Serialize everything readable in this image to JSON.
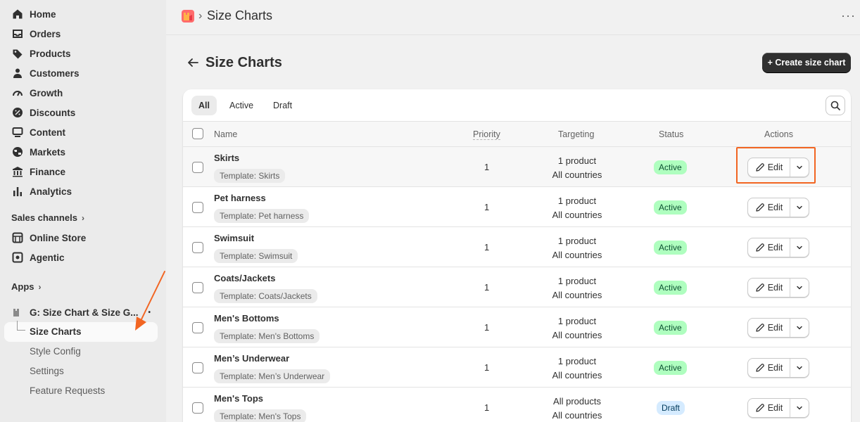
{
  "sidebar": {
    "nav": [
      {
        "label": "Home",
        "icon": "home-icon"
      },
      {
        "label": "Orders",
        "icon": "inbox-icon"
      },
      {
        "label": "Products",
        "icon": "tag-icon"
      },
      {
        "label": "Customers",
        "icon": "person-icon"
      },
      {
        "label": "Growth",
        "icon": "gauge-icon"
      },
      {
        "label": "Discounts",
        "icon": "discount-icon"
      },
      {
        "label": "Content",
        "icon": "content-icon"
      },
      {
        "label": "Markets",
        "icon": "globe-icon"
      },
      {
        "label": "Finance",
        "icon": "bank-icon"
      },
      {
        "label": "Analytics",
        "icon": "bar-chart-icon"
      }
    ],
    "sales_channels": {
      "heading": "Sales channels",
      "items": [
        {
          "label": "Online Store",
          "icon": "store-icon"
        },
        {
          "label": "Agentic",
          "icon": "agentic-icon"
        }
      ]
    },
    "apps": {
      "heading": "Apps",
      "app_name": "G: Size Chart & Size G...",
      "sub_items": [
        "Size Charts",
        "Style Config",
        "Settings",
        "Feature Requests"
      ]
    }
  },
  "topbar": {
    "breadcrumb_title": "Size Charts",
    "more": "···"
  },
  "page": {
    "title": "Size Charts",
    "create_button": "+ Create size chart"
  },
  "tabs": [
    "All",
    "Active",
    "Draft"
  ],
  "table": {
    "headers": [
      "Name",
      "Priority",
      "Targeting",
      "Status",
      "Actions"
    ],
    "edit_label": "Edit",
    "rows": [
      {
        "name": "Skirts",
        "template": "Template: Skirts",
        "priority": "1",
        "targeting_1": "1 product",
        "targeting_2": "All countries",
        "status": "Active"
      },
      {
        "name": "Pet harness",
        "template": "Template: Pet harness",
        "priority": "1",
        "targeting_1": "1 product",
        "targeting_2": "All countries",
        "status": "Active"
      },
      {
        "name": "Swimsuit",
        "template": "Template: Swimsuit",
        "priority": "1",
        "targeting_1": "1 product",
        "targeting_2": "All countries",
        "status": "Active"
      },
      {
        "name": "Coats/Jackets",
        "template": "Template: Coats/Jackets",
        "priority": "1",
        "targeting_1": "1 product",
        "targeting_2": "All countries",
        "status": "Active"
      },
      {
        "name": "Men's Bottoms",
        "template": "Template: Men's Bottoms",
        "priority": "1",
        "targeting_1": "1 product",
        "targeting_2": "All countries",
        "status": "Active"
      },
      {
        "name": "Men’s Underwear",
        "template": "Template: Men’s Underwear",
        "priority": "1",
        "targeting_1": "1 product",
        "targeting_2": "All countries",
        "status": "Active"
      },
      {
        "name": "Men's Tops",
        "template": "Template: Men's Tops",
        "priority": "1",
        "targeting_1": "All products",
        "targeting_2": "All countries",
        "status": "Draft"
      }
    ]
  },
  "colors": {
    "accent_annotation": "#f26522",
    "active_badge": "#affebf",
    "draft_badge": "#d5ebff",
    "primary_button": "#303030"
  }
}
